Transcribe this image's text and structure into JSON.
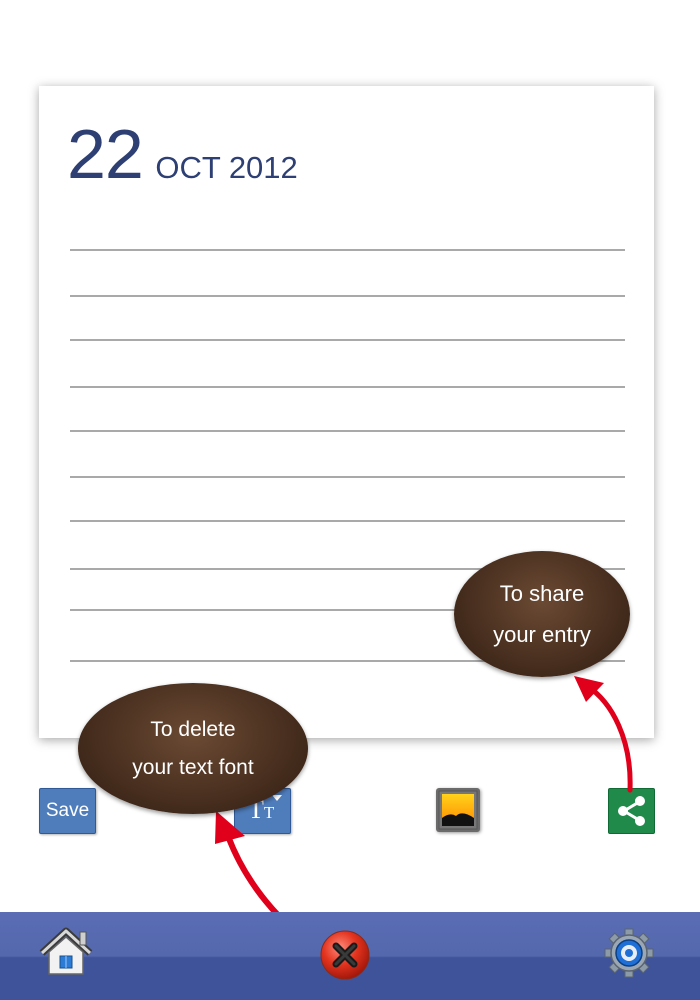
{
  "entry": {
    "day": "22",
    "month_year": "OCT 2012",
    "line_count": 10
  },
  "toolbar": {
    "save_label": "Save",
    "font_glyph": "TT",
    "icons": [
      "text-font-icon",
      "image-icon",
      "share-icon"
    ]
  },
  "tooltips": {
    "share": [
      "To share",
      "your entry"
    ],
    "delete": [
      "To delete",
      "your text font"
    ]
  },
  "bottom_nav": {
    "icons": [
      "home-icon",
      "close-icon",
      "settings-icon"
    ]
  },
  "colors": {
    "date_text": "#2d3f73",
    "button_blue": "#4f7dbc",
    "share_green": "#1f8a4a",
    "nav_bar": "#5468ad",
    "bubble_brown": "#4a3020",
    "arrow_red": "#e0001b"
  }
}
